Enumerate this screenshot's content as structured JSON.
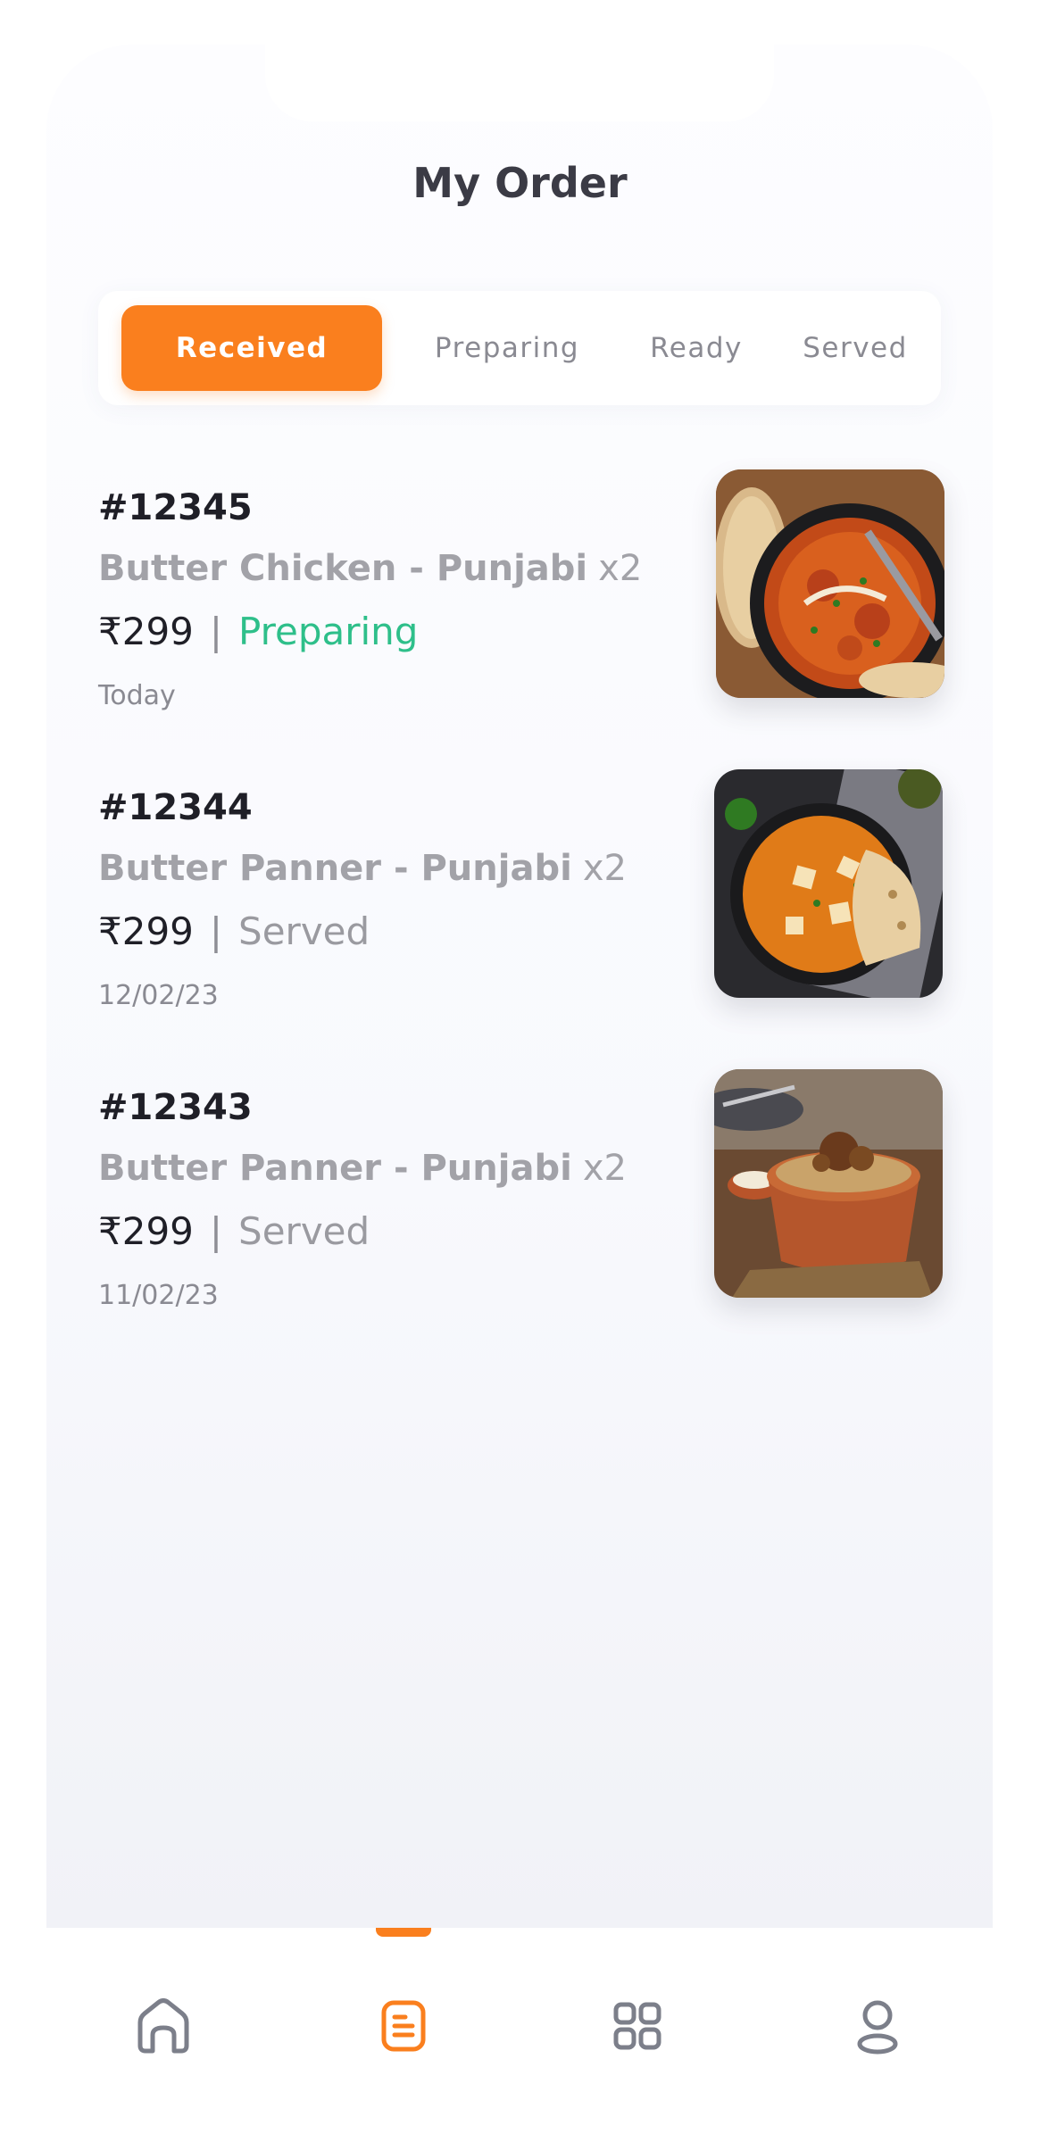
{
  "header": {
    "title": "My Order"
  },
  "tabs": [
    {
      "label": "Received",
      "active": true
    },
    {
      "label": "Preparing",
      "active": false
    },
    {
      "label": "Ready",
      "active": false
    },
    {
      "label": "Served",
      "active": false
    }
  ],
  "orders": [
    {
      "id": "#12345",
      "name": "Butter Chicken - Punjabi",
      "qty": "x2",
      "price": "₹299",
      "separator": "|",
      "status": "Preparing",
      "date": "Today",
      "image": "butter-chicken-dish"
    },
    {
      "id": "#12344",
      "name": "Butter Panner - Punjabi",
      "qty": "x2",
      "price": "₹299",
      "separator": "|",
      "status": "Served",
      "date": "12/02/23",
      "image": "paneer-curry-dish"
    },
    {
      "id": "#12343",
      "name": "Butter Panner - Punjabi",
      "qty": "x2",
      "price": "₹299",
      "separator": "|",
      "status": "Served",
      "date": "11/02/23",
      "image": "biryani-pot-dish"
    }
  ],
  "nav": {
    "items": [
      {
        "name": "home",
        "icon": "home-icon",
        "active": false
      },
      {
        "name": "orders",
        "icon": "orders-icon",
        "active": true
      },
      {
        "name": "menu",
        "icon": "grid-icon",
        "active": false
      },
      {
        "name": "profile",
        "icon": "profile-icon",
        "active": false
      }
    ]
  },
  "colors": {
    "accent": "#fa7f1e",
    "preparing": "#2ebf8a",
    "muted": "#a2a2a8",
    "text": "#1f1f27"
  }
}
